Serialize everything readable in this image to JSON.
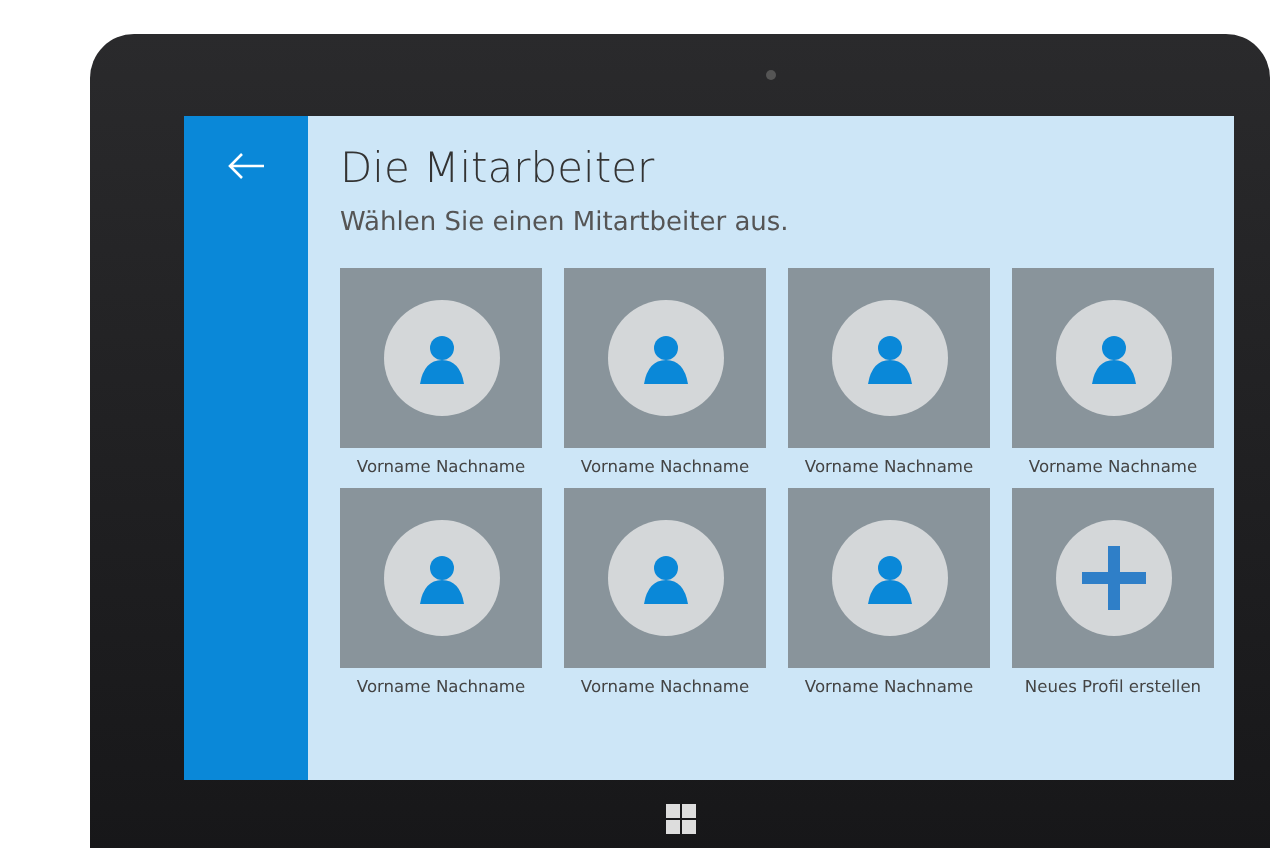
{
  "page": {
    "title": "Die Mitarbeiter",
    "subtitle": "Wählen Sie einen Mitartbeiter aus."
  },
  "tiles": [
    {
      "kind": "person",
      "label": "Vorname Nachname"
    },
    {
      "kind": "person",
      "label": "Vorname Nachname"
    },
    {
      "kind": "person",
      "label": "Vorname Nachname"
    },
    {
      "kind": "person",
      "label": "Vorname Nachname"
    },
    {
      "kind": "person",
      "label": "Vorname Nachname"
    },
    {
      "kind": "person",
      "label": "Vorname Nachname"
    },
    {
      "kind": "person",
      "label": "Vorname Nachname"
    },
    {
      "kind": "add",
      "label": "Neues Profil erstellen"
    }
  ]
}
